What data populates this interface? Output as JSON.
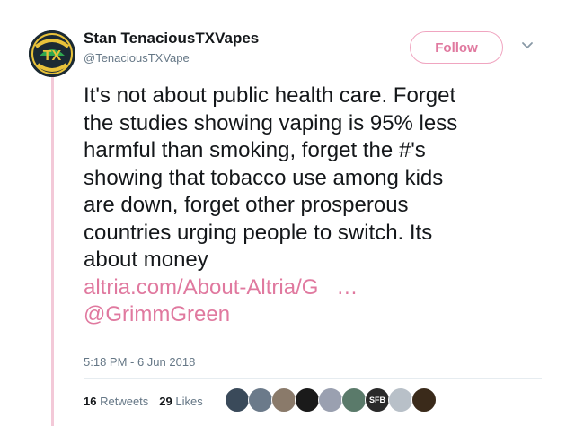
{
  "author": {
    "name": "Stan TenaciousTXVapes",
    "handle": "@TenaciousTXVape",
    "avatar_text": "TENACIOUS TX VAPE"
  },
  "follow_label": "Follow",
  "tweet": {
    "lines": [
      "It's not about public health care. Forget",
      "the studies showing vaping is 95% less",
      "harmful than smoking, forget the #'s",
      "showing that tobacco use among kids",
      "are down, forget other prosperous",
      "countries urging people to switch. Its",
      "about money"
    ],
    "link": "altria.com/About-Altria/G   …",
    "mention": "@GrimmGreen"
  },
  "timestamp": "5:18 PM - 6 Jun 2018",
  "stats": {
    "retweets_count": "16",
    "retweets_label": "Retweets",
    "likes_count": "29",
    "likes_label": "Likes"
  },
  "liker_avatars": [
    {
      "color": "#3a4a5a",
      "icon": "avatar"
    },
    {
      "color": "#6b7a8a",
      "icon": "avatar"
    },
    {
      "color": "#8a7a6a",
      "icon": "avatar"
    },
    {
      "color": "#1a1a1a",
      "icon": "avatar"
    },
    {
      "color": "#9aa0b0",
      "icon": "avatar"
    },
    {
      "color": "#5a7a6a",
      "icon": "avatar"
    },
    {
      "color": "#2a2a2a",
      "icon": "avatar",
      "text": "SFB"
    },
    {
      "color": "#b8c0c8",
      "icon": "avatar"
    },
    {
      "color": "#3a2a1a",
      "icon": "avatar"
    }
  ],
  "colors": {
    "accent": "#e0799f",
    "thread_line": "#f3c9d8",
    "muted": "#657786"
  }
}
